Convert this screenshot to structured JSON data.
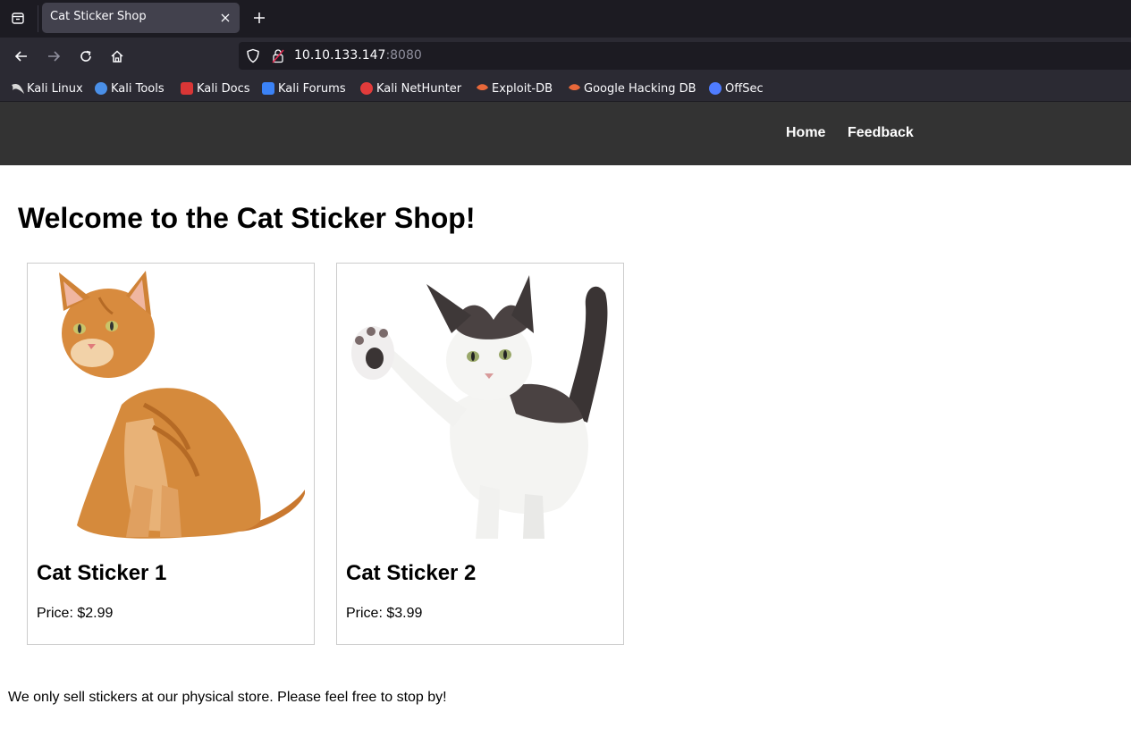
{
  "browser": {
    "tab": {
      "title": "Cat Sticker Shop"
    },
    "url": {
      "host": "10.10.133.147",
      "port": ":8080"
    },
    "bookmarks": [
      {
        "label": "Kali Linux",
        "icon": "kali-dragon-icon",
        "color": "#d0d0d0"
      },
      {
        "label": "Kali Tools",
        "icon": "kali-tools-icon",
        "color": "#4a8fe7"
      },
      {
        "label": "Kali Docs",
        "icon": "kali-docs-icon",
        "color": "#d93636"
      },
      {
        "label": "Kali Forums",
        "icon": "kali-forums-icon",
        "color": "#3b82f6"
      },
      {
        "label": "Kali NetHunter",
        "icon": "kali-nethunter-icon",
        "color": "#e23b3b"
      },
      {
        "label": "Exploit-DB",
        "icon": "exploit-db-icon",
        "color": "#e8683a"
      },
      {
        "label": "Google Hacking DB",
        "icon": "ghdb-icon",
        "color": "#e8683a"
      },
      {
        "label": "OffSec",
        "icon": "offsec-icon",
        "color": "#4f7cff"
      }
    ]
  },
  "site": {
    "nav": {
      "home": "Home",
      "feedback": "Feedback"
    },
    "title": "Welcome to the Cat Sticker Shop!",
    "products": [
      {
        "name": "Cat Sticker 1",
        "price": "Price: $2.99",
        "image": "orange-tabby-cat-photo"
      },
      {
        "name": "Cat Sticker 2",
        "price": "Price: $3.99",
        "image": "white-grey-kitten-photo"
      }
    ],
    "footer": "We only sell stickers at our physical store. Please feel free to stop by!"
  },
  "colors": {
    "header_bg": "#333333",
    "chrome_dark": "#1c1b22",
    "chrome_mid": "#2b2a33"
  }
}
